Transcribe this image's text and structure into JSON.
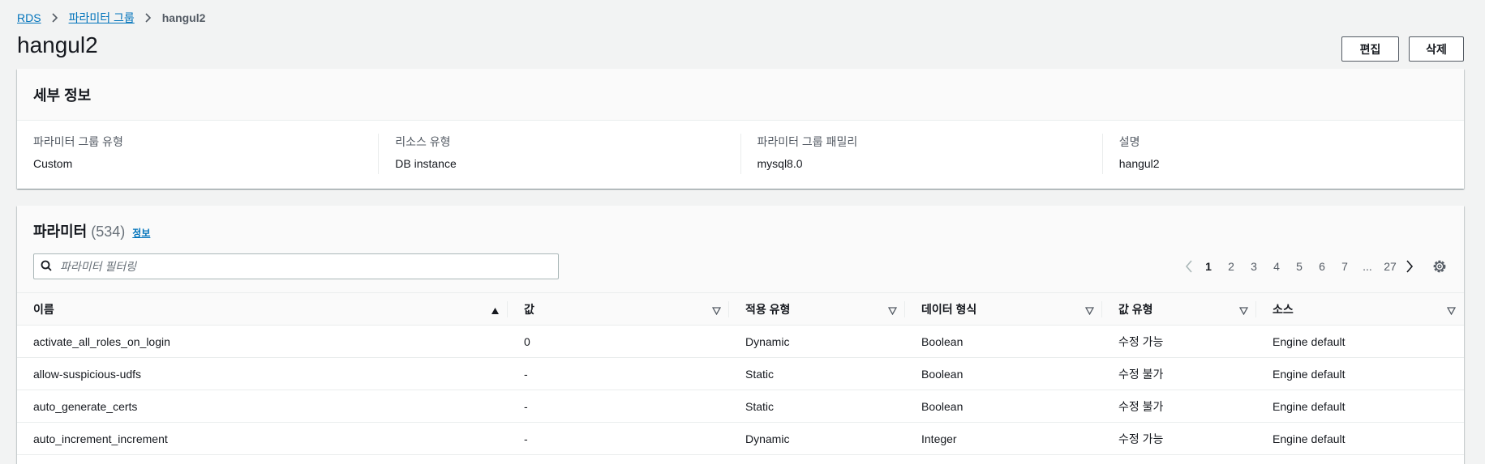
{
  "breadcrumb": {
    "root": "RDS",
    "parent": "파라미터 그룹",
    "current": "hangul2"
  },
  "page_title": "hangul2",
  "actions": {
    "edit": "편집",
    "delete": "삭제"
  },
  "details": {
    "title": "세부 정보",
    "fields": [
      {
        "label": "파라미터 그룹 유형",
        "value": "Custom"
      },
      {
        "label": "리소스 유형",
        "value": "DB instance"
      },
      {
        "label": "파라미터 그룹 패밀리",
        "value": "mysql8.0"
      },
      {
        "label": "설명",
        "value": "hangul2"
      }
    ]
  },
  "params": {
    "title": "파라미터",
    "count": "(534)",
    "info": "정보",
    "search_placeholder": "파라미터 필터링",
    "pages": [
      "1",
      "2",
      "3",
      "4",
      "5",
      "6",
      "7",
      "...",
      "27"
    ],
    "active_page": "1",
    "columns": [
      "이름",
      "값",
      "적용 유형",
      "데이터 형식",
      "값 유형",
      "소스"
    ],
    "rows": [
      [
        "activate_all_roles_on_login",
        "0",
        "Dynamic",
        "Boolean",
        "수정 가능",
        "Engine default"
      ],
      [
        "allow-suspicious-udfs",
        "-",
        "Static",
        "Boolean",
        "수정 불가",
        "Engine default"
      ],
      [
        "auto_generate_certs",
        "-",
        "Static",
        "Boolean",
        "수정 불가",
        "Engine default"
      ],
      [
        "auto_increment_increment",
        "-",
        "Dynamic",
        "Integer",
        "수정 가능",
        "Engine default"
      ]
    ]
  },
  "colors": {
    "link": "#0073bb",
    "text": "#16191f",
    "muted": "#545b64",
    "bg": "#f2f3f3"
  },
  "icons": [
    "chevron-right-icon",
    "search-icon",
    "chevron-left-icon",
    "settings-gear-icon",
    "sort-ascending-icon",
    "sort-descending-icon"
  ]
}
